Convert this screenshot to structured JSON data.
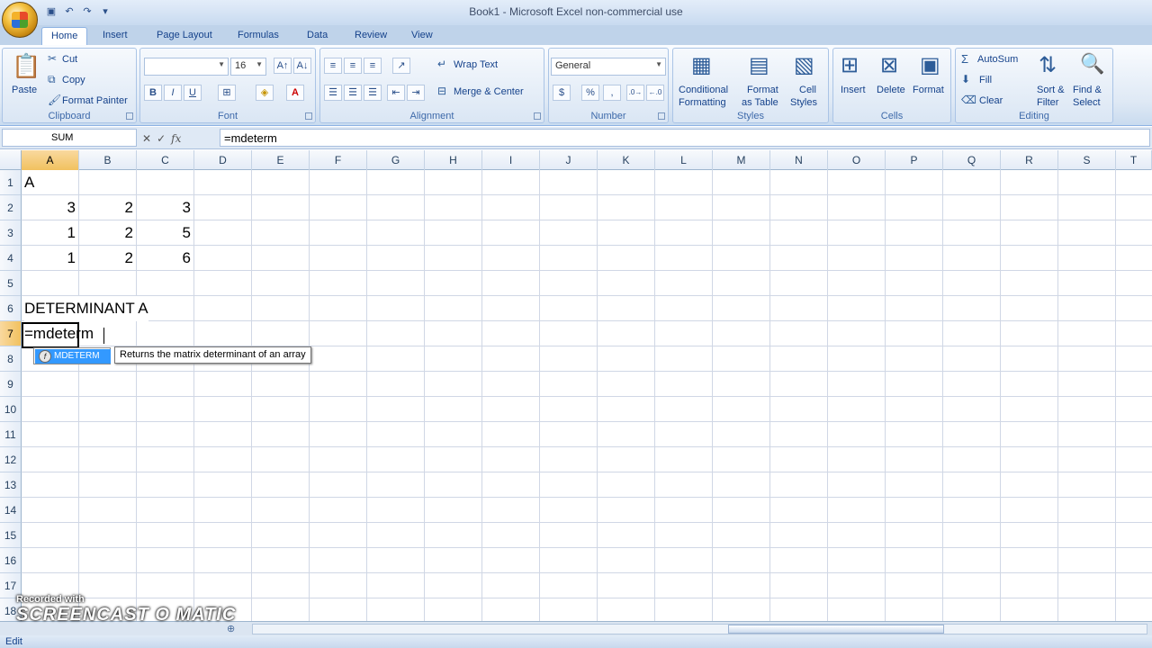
{
  "window": {
    "title": "Book1 - Microsoft Excel non-commercial use"
  },
  "tabs": [
    "Home",
    "Insert",
    "Page Layout",
    "Formulas",
    "Data",
    "Review",
    "View"
  ],
  "ribbon": {
    "clipboard": {
      "label": "Clipboard",
      "paste": "Paste",
      "cut": "Cut",
      "copy": "Copy",
      "format_painter": "Format Painter"
    },
    "font": {
      "label": "Font",
      "font_size": "16",
      "bold": "B",
      "italic": "I",
      "underline": "U",
      "font_color_glyph": "A"
    },
    "alignment": {
      "label": "Alignment",
      "wrap_text": "Wrap Text",
      "merge_center": "Merge & Center"
    },
    "number": {
      "label": "Number",
      "format": "General",
      "percent": "%",
      "comma": ","
    },
    "styles": {
      "label": "Styles",
      "conditional_1": "Conditional",
      "conditional_2": "Formatting",
      "format_table_1": "Format",
      "format_table_2": "as Table",
      "cell_styles_1": "Cell",
      "cell_styles_2": "Styles"
    },
    "cells": {
      "label": "Cells",
      "insert": "Insert",
      "delete": "Delete",
      "format": "Format"
    },
    "editing": {
      "label": "Editing",
      "autosum": "AutoSum",
      "fill": "Fill",
      "clear": "Clear",
      "sort_1": "Sort &",
      "sort_2": "Filter",
      "find_1": "Find &",
      "find_2": "Select"
    }
  },
  "formula_bar": {
    "name_box": "SUM",
    "fx": "fx",
    "value": "=mdeterm"
  },
  "columns": [
    "A",
    "B",
    "C",
    "D",
    "E",
    "F",
    "G",
    "H",
    "I",
    "J",
    "K",
    "L",
    "M",
    "N",
    "O",
    "P",
    "Q",
    "R",
    "S",
    "T"
  ],
  "rows": [
    "1",
    "2",
    "3",
    "4",
    "5",
    "6",
    "7",
    "8",
    "9",
    "10",
    "11",
    "12",
    "13",
    "14",
    "15",
    "16",
    "17",
    "18"
  ],
  "cells": {
    "A1": "A",
    "A2": "3",
    "B2": "2",
    "C2": "3",
    "A3": "1",
    "B3": "2",
    "C3": "5",
    "A4": "1",
    "B4": "2",
    "C4": "6",
    "A6": "DETERMINANT A",
    "A7": "=mdeterm"
  },
  "autocomplete": {
    "item": "MDETERM",
    "tooltip": "Returns the matrix determinant of an array"
  },
  "status": {
    "mode": "Edit"
  },
  "watermark": {
    "line1": "Recorded with",
    "line2": "SCREENCAST  O  MATIC"
  }
}
